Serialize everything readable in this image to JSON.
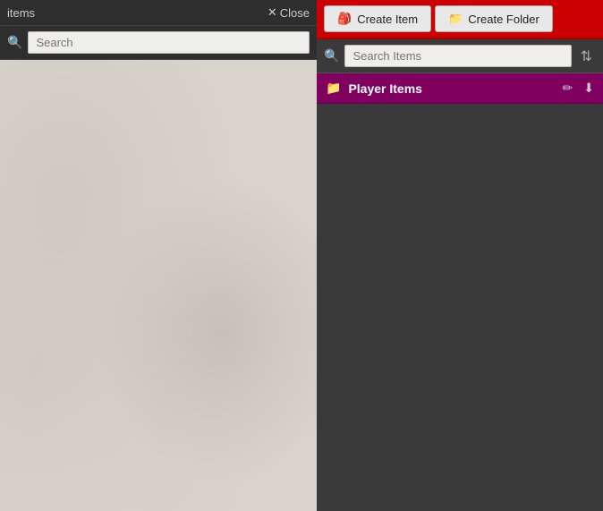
{
  "left_panel": {
    "title": "items",
    "close_label": "Close",
    "search_placeholder": "Search"
  },
  "right_panel": {
    "create_item_label": "Create Item",
    "create_folder_label": "Create Folder",
    "search_placeholder": "Search Items",
    "player_items_label": "Player Items",
    "create_item_icon": "🎒",
    "create_folder_icon": "📁",
    "folder_icon": "📁",
    "edit_icon": "✏",
    "download_icon": "⬇"
  },
  "icons": {
    "close": "✕",
    "search": "🔍",
    "sort": "≡"
  }
}
